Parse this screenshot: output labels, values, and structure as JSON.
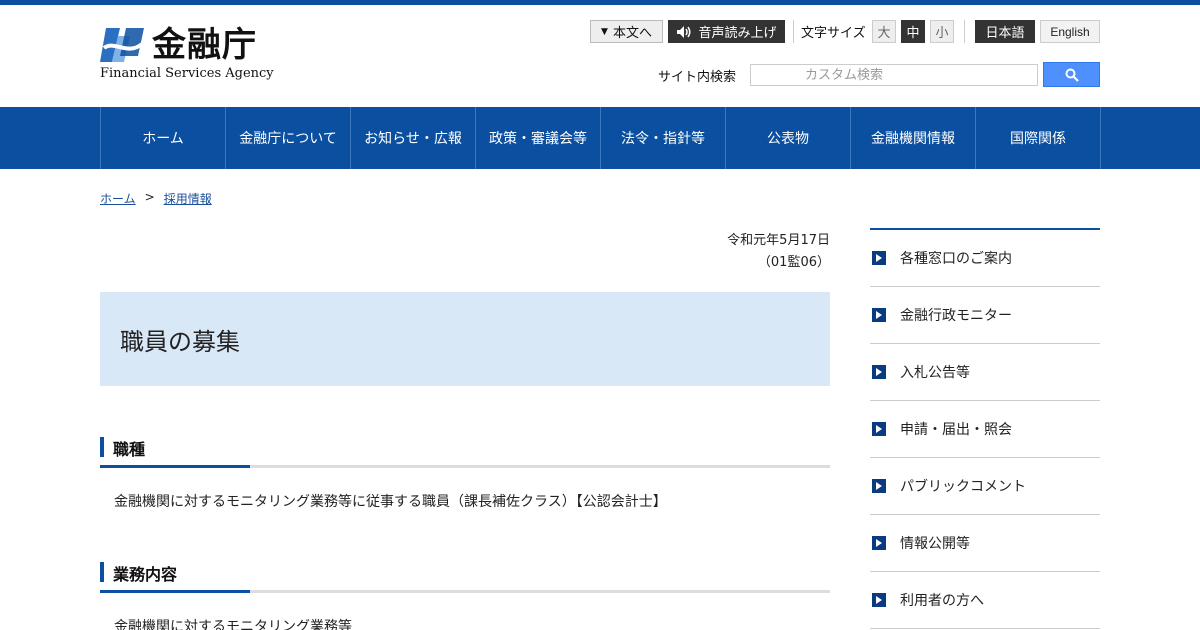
{
  "header": {
    "logo_jp": "金融庁",
    "logo_en": "Financial Services Agency",
    "skip_label": "本文へ",
    "read_label": "音声読み上げ",
    "fontsize_label": "文字サイズ",
    "fontsize_options": [
      "大",
      "中",
      "小"
    ],
    "lang_ja": "日本語",
    "lang_en": "English",
    "search_label": "サイト内検索",
    "search_placeholder": "カスタム検索"
  },
  "nav": {
    "items": [
      "ホーム",
      "金融庁について",
      "お知らせ・広報",
      "政策・審議会等",
      "法令・指針等",
      "公表物",
      "金融機関情報",
      "国際関係"
    ]
  },
  "breadcrumb": {
    "home": "ホーム",
    "separator": ">",
    "current": "採用情報"
  },
  "main": {
    "date": "令和元年5月17日",
    "doc_no": "（01監06）",
    "title": "職員の募集",
    "sections": [
      {
        "heading": "職種",
        "text": "金融機関に対するモニタリング業務等に従事する職員（課長補佐クラス）【公認会計士】"
      },
      {
        "heading": "業務内容",
        "text": "金融機関に対するモニタリング業務等"
      }
    ]
  },
  "sidebar": {
    "items": [
      "各種窓口のご案内",
      "金融行政モニター",
      "入札公告等",
      "申請・届出・照会",
      "パブリックコメント",
      "情報公開等",
      "利用者の方へ"
    ]
  },
  "colors": {
    "brand_blue": "#0a4fa0",
    "title_bg": "#d9e8f7",
    "search_button": "#4d90fe"
  }
}
